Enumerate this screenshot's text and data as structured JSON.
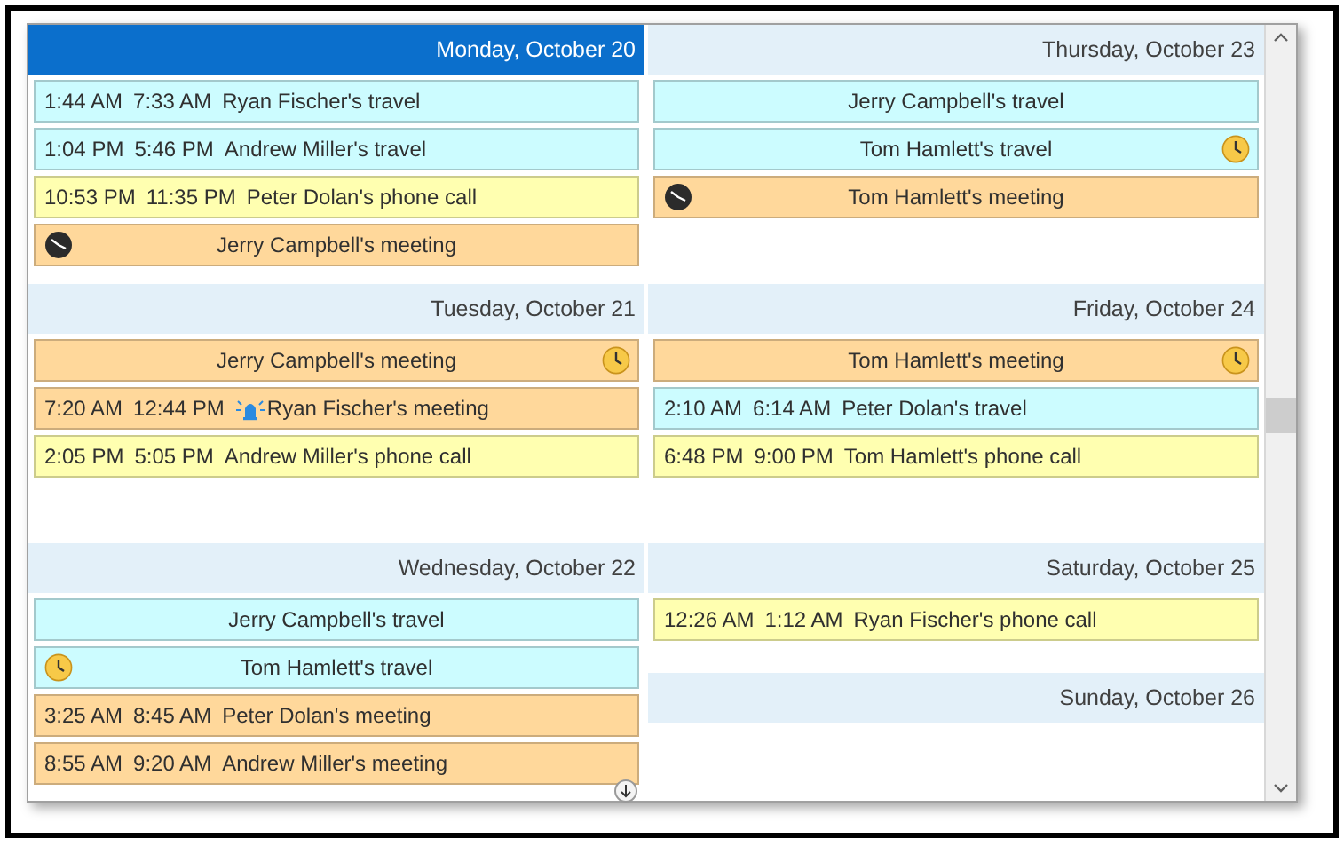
{
  "columns": [
    {
      "days": [
        {
          "label": "Monday, October 20",
          "selected": true,
          "events": [
            {
              "kind": "timed",
              "start": "1:44 AM",
              "end": "7:33 AM",
              "subject": "Ryan Fischer's travel",
              "color": "#ccfcff"
            },
            {
              "kind": "timed",
              "start": "1:04 PM",
              "end": "5:46 PM",
              "subject": "Andrew Miller's travel",
              "color": "#ccfcff"
            },
            {
              "kind": "timed",
              "start": "10:53 PM",
              "end": "11:35 PM",
              "subject": "Peter Dolan's phone call",
              "color": "#ffffb0"
            },
            {
              "kind": "earlier",
              "subject": "Jerry Campbell's meeting",
              "color": "#ffd89b"
            }
          ]
        },
        {
          "label": "Tuesday, October 21",
          "selected": false,
          "events": [
            {
              "kind": "later",
              "subject": "Jerry Campbell's meeting",
              "color": "#ffd89b"
            },
            {
              "kind": "reminder",
              "start": "7:20 AM",
              "end": "12:44 PM",
              "subject": "Ryan Fischer's meeting",
              "color": "#ffd89b"
            },
            {
              "kind": "timed",
              "start": "2:05 PM",
              "end": "5:05 PM",
              "subject": "Andrew Miller's phone call",
              "color": "#ffffb0"
            }
          ]
        },
        {
          "label": "Wednesday, October 22",
          "selected": false,
          "more_below": true,
          "events": [
            {
              "kind": "allday",
              "subject": "Jerry Campbell's travel",
              "color": "#ccfcff"
            },
            {
              "kind": "started",
              "subject": "Tom Hamlett's travel",
              "color": "#ccfcff"
            },
            {
              "kind": "timed",
              "start": "3:25 AM",
              "end": "8:45 AM",
              "subject": "Peter Dolan's meeting",
              "color": "#ffd89b"
            },
            {
              "kind": "timed",
              "start": "8:55 AM",
              "end": "9:20 AM",
              "subject": "Andrew Miller's meeting",
              "color": "#ffd89b"
            }
          ]
        }
      ]
    },
    {
      "days": [
        {
          "label": "Thursday, October 23",
          "selected": false,
          "events": [
            {
              "kind": "allday",
              "subject": "Jerry Campbell's travel",
              "color": "#ccfcff"
            },
            {
              "kind": "later",
              "subject": "Tom Hamlett's travel",
              "color": "#ccfcff"
            },
            {
              "kind": "earlier",
              "subject": "Tom Hamlett's meeting",
              "color": "#ffd89b"
            }
          ]
        },
        {
          "label": "Friday, October 24",
          "selected": false,
          "events": [
            {
              "kind": "later",
              "subject": "Tom Hamlett's meeting",
              "color": "#ffd89b"
            },
            {
              "kind": "timed",
              "start": "2:10 AM",
              "end": "6:14 AM",
              "subject": "Peter Dolan's travel",
              "color": "#ccfcff"
            },
            {
              "kind": "timed",
              "start": "6:48 PM",
              "end": "9:00 PM",
              "subject": "Tom Hamlett's phone call",
              "color": "#ffffb0"
            }
          ]
        },
        {
          "label": "Saturday, October 25",
          "selected": false,
          "events": [
            {
              "kind": "timed",
              "start": "12:26 AM",
              "end": "1:12 AM",
              "subject": "Ryan Fischer's phone call",
              "color": "#ffffb0"
            }
          ]
        },
        {
          "label": "Sunday, October 26",
          "selected": false
        }
      ]
    }
  ]
}
